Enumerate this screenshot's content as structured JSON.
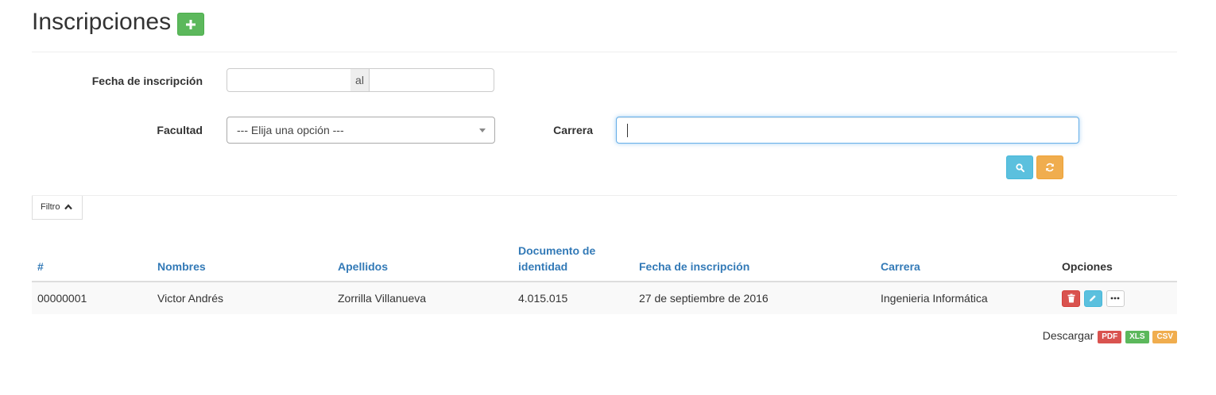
{
  "header": {
    "title": "Inscripciones",
    "add_icon": "plus-icon",
    "add_color": "#5cb85c"
  },
  "filters": {
    "fecha_label": "Fecha de inscripción",
    "fecha_from_value": "",
    "fecha_separator": "al",
    "fecha_to_value": "",
    "facultad_label": "Facultad",
    "facultad_selected": "--- Elija una opción ---",
    "carrera_label": "Carrera",
    "carrera_value": "",
    "search_icon": "search-icon",
    "reset_icon": "refresh-icon",
    "toggle_label": "Filtro"
  },
  "table": {
    "columns": [
      "#",
      "Nombres",
      "Apellidos",
      "Documento de identidad",
      "Fecha de inscripción",
      "Carrera",
      "Opciones"
    ],
    "rows": [
      {
        "id": "00000001",
        "nombres": "Victor Andrés",
        "apellidos": "Zorrilla Villanueva",
        "documento": "4.015.015",
        "fecha": "27 de septiembre de 2016",
        "carrera": "Ingenieria Informática"
      }
    ]
  },
  "download": {
    "label": "Descargar",
    "formats": [
      "PDF",
      "XLS",
      "CSV"
    ]
  }
}
